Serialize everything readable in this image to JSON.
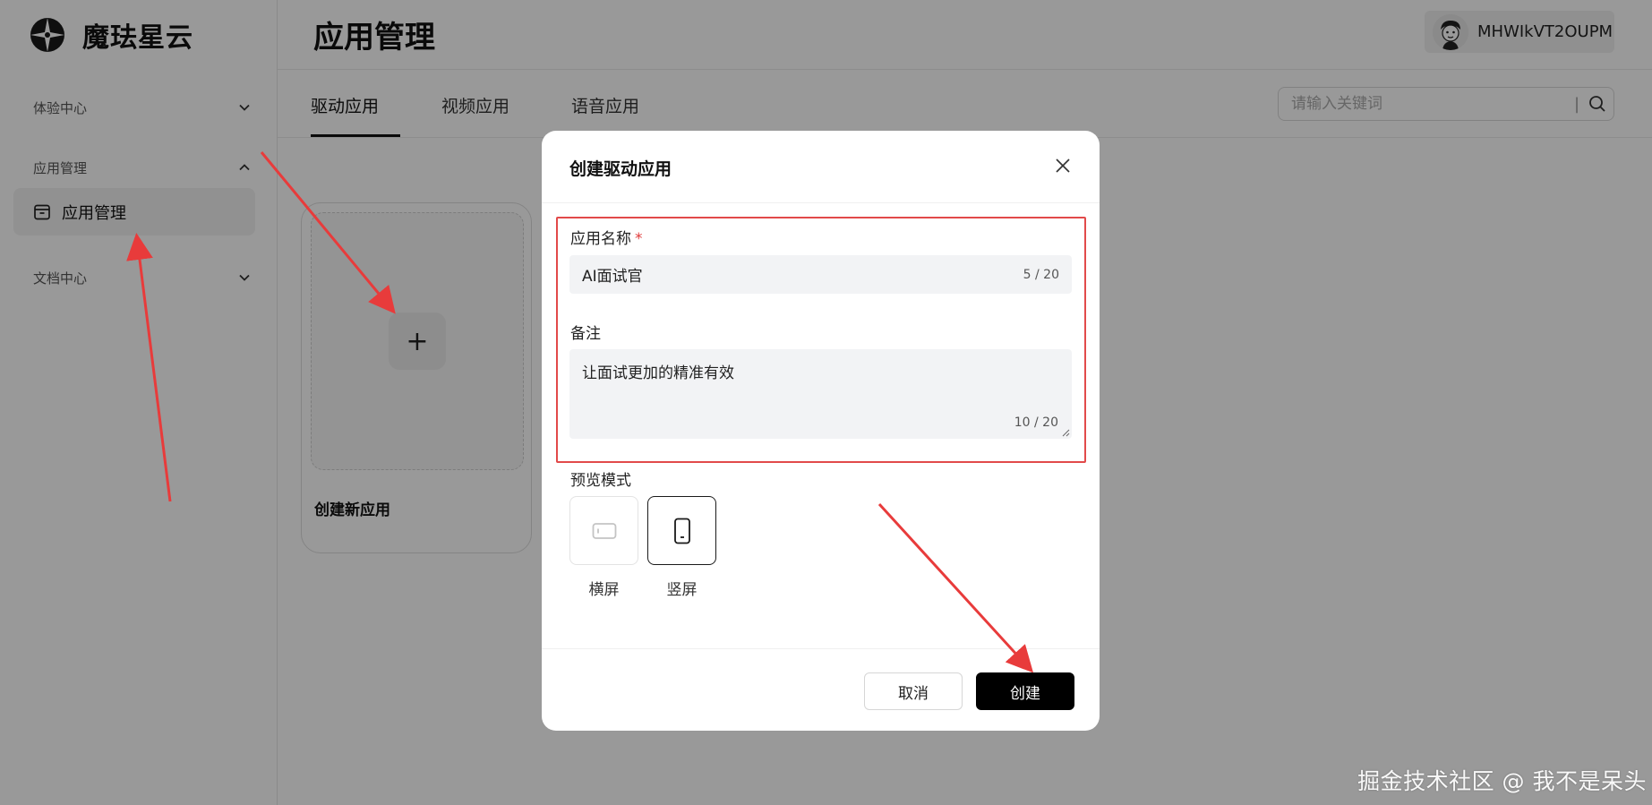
{
  "brand": {
    "name": "魔珐星云"
  },
  "sidebar": {
    "groups": [
      {
        "label": "体验中心"
      },
      {
        "label": "应用管理"
      },
      {
        "label": "文档中心"
      }
    ],
    "active_item": {
      "label": "应用管理"
    }
  },
  "header": {
    "title": "应用管理",
    "user_name": "MHWIkVT2OUPM"
  },
  "tabs": [
    {
      "label": "驱动应用",
      "active": true
    },
    {
      "label": "视频应用",
      "active": false
    },
    {
      "label": "语音应用",
      "active": false
    }
  ],
  "search": {
    "placeholder": "请输入关键词",
    "separator": "|"
  },
  "card": {
    "label": "创建新应用",
    "plus": "+"
  },
  "modal": {
    "title": "创建驱动应用",
    "name_field": {
      "label": "应用名称",
      "required_mark": "*",
      "value": "AI面试官",
      "counter": "5 / 20"
    },
    "note_field": {
      "label": "备注",
      "value": "让面试更加的精准有效",
      "counter": "10 / 20"
    },
    "preview": {
      "label": "预览模式",
      "options": [
        {
          "label": "横屏",
          "selected": false
        },
        {
          "label": "竖屏",
          "selected": true
        }
      ]
    },
    "cancel_label": "取消",
    "create_label": "创建"
  },
  "watermark": "掘金技术社区 @ 我不是呆头",
  "colors": {
    "highlight": "#e24a4a",
    "arrow": "#e83b3b",
    "primary_button": "#000000"
  }
}
